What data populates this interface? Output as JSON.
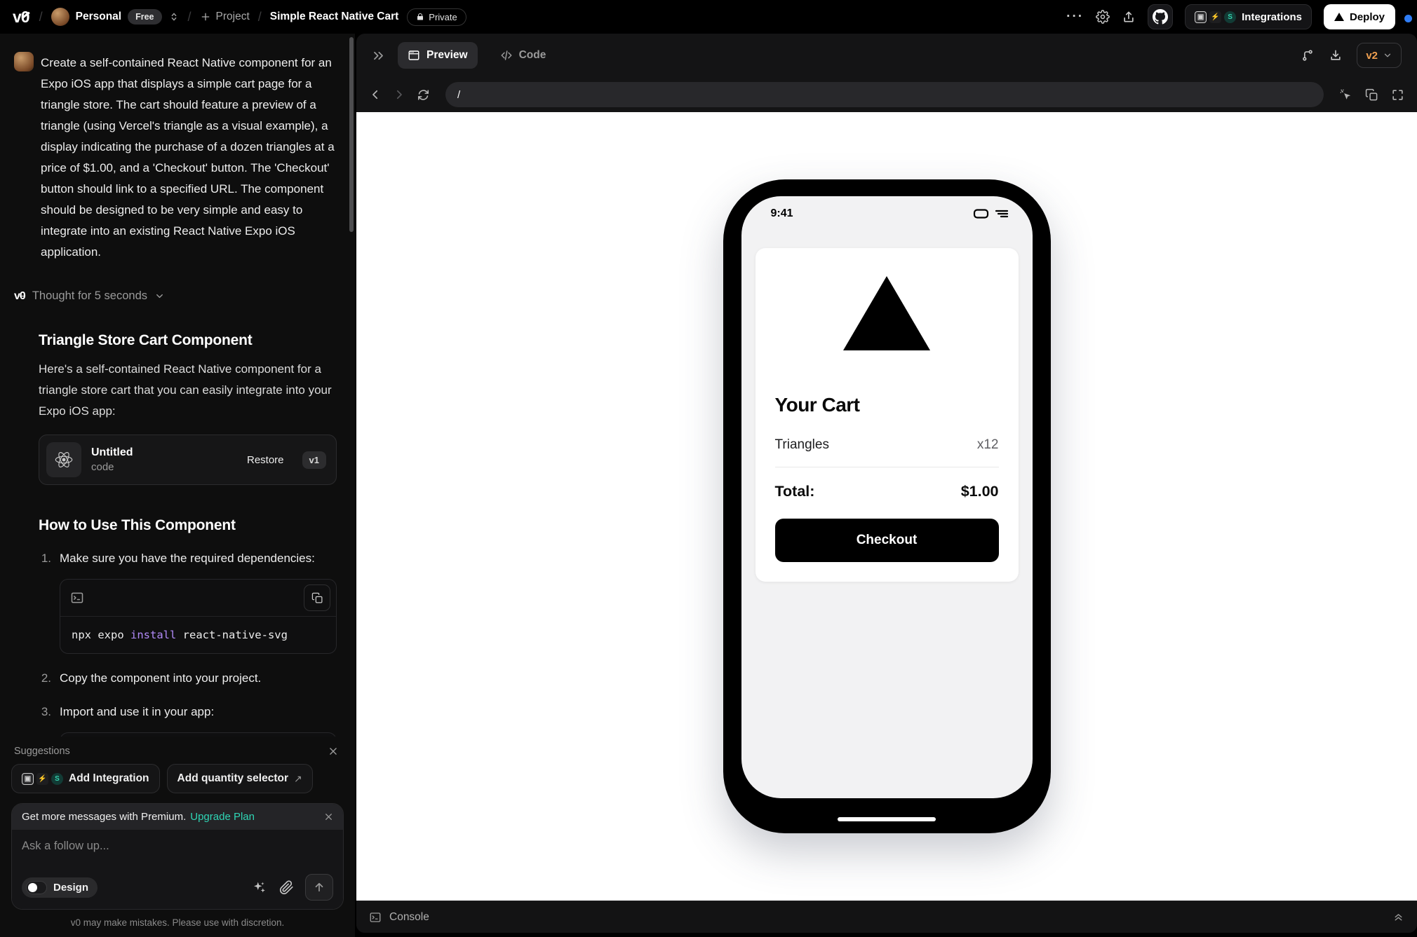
{
  "header": {
    "workspace": "Personal",
    "plan_badge": "Free",
    "new_project_label": "Project",
    "chat_title": "Simple React Native Cart",
    "privacy_badge": "Private",
    "integrations_label": "Integrations",
    "deploy_label": "Deploy"
  },
  "chat": {
    "user_message": "Create a self-contained React Native component for an Expo iOS app that displays a simple cart page for a triangle store. The cart should feature a preview of a triangle (using Vercel's triangle as a visual example), a display indicating the purchase of a dozen triangles at a price of $1.00, and a 'Checkout' button. The 'Checkout' button should link to a specified URL. The component should be designed to be very simple and easy to integrate into an existing React Native Expo iOS application.",
    "thought_label": "Thought for 5 seconds",
    "response_title": "Triangle Store Cart Component",
    "response_intro": "Here's a self-contained React Native component for a triangle store cart that you can easily integrate into your Expo iOS app:",
    "code_card": {
      "title": "Untitled",
      "subtitle": "code",
      "restore_label": "Restore",
      "version": "v1"
    },
    "howto_title": "How to Use This Component",
    "steps": [
      {
        "num": "1.",
        "text": "Make sure you have the required dependencies:"
      },
      {
        "num": "2.",
        "text": "Copy the component into your project."
      },
      {
        "num": "3.",
        "text": "Import and use it in your app:"
      }
    ],
    "code_snippet": {
      "prefix": "npx expo ",
      "keyword": "install",
      "suffix": " react-native-svg"
    },
    "suggestions": {
      "label": "Suggestions",
      "items": [
        "Add Integration",
        "Add quantity selector"
      ]
    },
    "premium_banner": {
      "text": "Get more messages with Premium.",
      "link": "Upgrade Plan"
    },
    "composer": {
      "placeholder": "Ask a follow up...",
      "design_label": "Design"
    },
    "disclaimer": "v0 may make mistakes. Please use with discretion."
  },
  "workbench": {
    "tabs": [
      {
        "label": "Preview",
        "active": true
      },
      {
        "label": "Code",
        "active": false
      }
    ],
    "version_selector": "v2",
    "url": "/",
    "console_label": "Console"
  },
  "preview": {
    "status_time": "9:41",
    "cart": {
      "title": "Your Cart",
      "item_name": "Triangles",
      "item_qty": "x12",
      "total_label": "Total:",
      "total_value": "$1.00",
      "checkout_label": "Checkout"
    }
  },
  "colors": {
    "accent_teal": "#2fd5b5",
    "version_amber": "#f0a050",
    "code_keyword_purple": "#b18af8",
    "notification_blue": "#2f7df6",
    "phone_frame": "#000000",
    "phone_screen": "#f2f2f3"
  }
}
